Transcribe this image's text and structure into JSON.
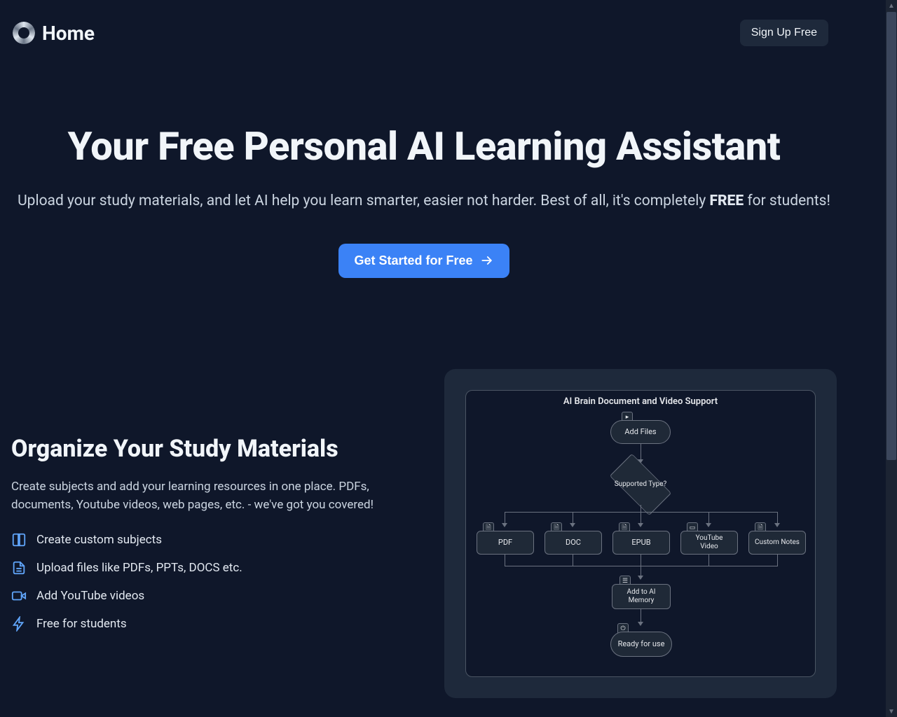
{
  "header": {
    "home_label": "Home",
    "signup_label": "Sign Up Free"
  },
  "hero": {
    "title": "Your Free Personal AI Learning Assistant",
    "sub_before": "Upload your study materials, and let AI help you learn smarter, easier not harder. Best of all, it's completely ",
    "sub_free": "FREE",
    "sub_after": " for students!",
    "cta_label": "Get Started for Free"
  },
  "features": {
    "heading": "Organize Your Study Materials",
    "description": "Create subjects and add your learning resources in one place. PDFs, documents, Youtube videos, web pages, etc. - we've got you covered!",
    "items": [
      {
        "label": "Create custom subjects"
      },
      {
        "label": "Upload files like PDFs, PPTs, DOCS etc."
      },
      {
        "label": "Add YouTube videos"
      },
      {
        "label": "Free for students"
      }
    ]
  },
  "diagram": {
    "title": "AI Brain Document and Video Support",
    "add_files": "Add Files",
    "supported_type": "Supported Type?",
    "formats": [
      "PDF",
      "DOC",
      "EPUB",
      "YouTube Video",
      "Custom Notes"
    ],
    "add_memory": "Add to AI Memory",
    "ready": "Ready for use"
  },
  "colors": {
    "bg": "#0f172a",
    "card": "#1e293b",
    "accent": "#3b82f6",
    "icon": "#60a5fa"
  }
}
